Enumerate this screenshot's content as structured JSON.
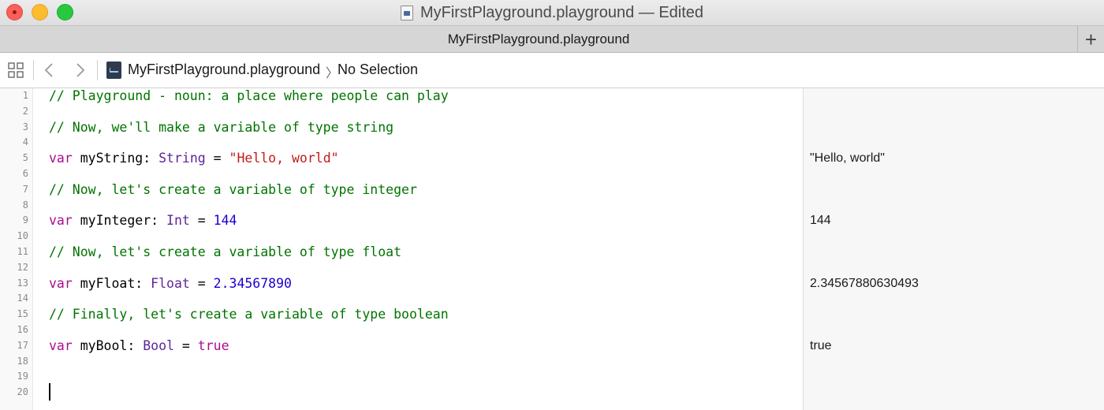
{
  "window": {
    "title": "MyFirstPlayground.playground — Edited"
  },
  "tabbar": {
    "tab_label": "MyFirstPlayground.playground",
    "add_tab_glyph": "+"
  },
  "jumpbar": {
    "file_label": "MyFirstPlayground.playground",
    "chevron": "〉",
    "selection_label": "No Selection",
    "icons": [
      "grid-icon",
      "back-icon",
      "forward-icon",
      "playground-file-icon"
    ]
  },
  "colors": {
    "comment": "#007400",
    "keyword": "#aa0d91",
    "type": "#5c2699",
    "string": "#c41a16",
    "number": "#1c00cf"
  },
  "editor": {
    "line_numbers": [
      "1",
      "2",
      "3",
      "4",
      "5",
      "6",
      "7",
      "8",
      "9",
      "10",
      "11",
      "12",
      "13",
      "14",
      "15",
      "16",
      "17",
      "18",
      "19",
      "20"
    ],
    "lines": {
      "l1": "// Playground - noun: a place where people can play",
      "l3": "// Now, we'll make a variable of type string",
      "l5": {
        "kw": "var",
        "name": " myString: ",
        "type": "String",
        "eq": " = ",
        "value": "\"Hello, world\""
      },
      "l7": "// Now, let's create a variable of type integer",
      "l9": {
        "kw": "var",
        "name": " myInteger: ",
        "type": "Int",
        "eq": " = ",
        "value": "144"
      },
      "l11": "// Now, let's create a variable of type float",
      "l13": {
        "kw": "var",
        "name": " myFloat: ",
        "type": "Float",
        "eq": " = ",
        "value": "2.34567890"
      },
      "l15": "// Finally, let's create a variable of type boolean",
      "l17": {
        "kw": "var",
        "name": " myBool: ",
        "type": "Bool",
        "eq": " = ",
        "value": "true"
      }
    }
  },
  "results": {
    "r5": "\"Hello, world\"",
    "r9": "144",
    "r13": "2.34567880630493",
    "r17": "true"
  }
}
